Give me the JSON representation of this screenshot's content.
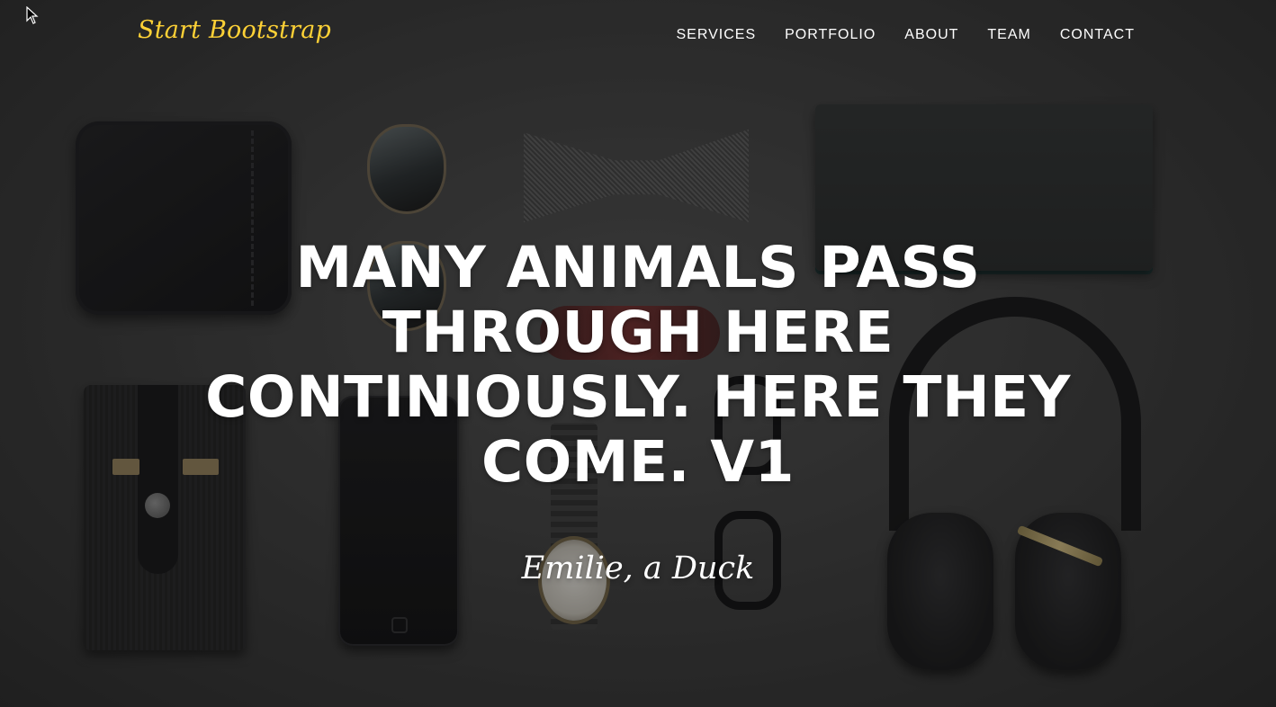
{
  "navbar": {
    "brand": "Start Bootstrap",
    "items": [
      {
        "label": "SERVICES"
      },
      {
        "label": "PORTFOLIO"
      },
      {
        "label": "ABOUT"
      },
      {
        "label": "TEAM"
      },
      {
        "label": "CONTACT"
      }
    ]
  },
  "hero": {
    "heading": "MANY ANIMALS PASS THROUGH HERE CONTINIOUSLY. HERE THEY COME. V1",
    "subheading": "Emilie, a Duck"
  },
  "colors": {
    "brand": "#fed136",
    "text": "#ffffff"
  },
  "icons": {
    "cursor": "mouse-pointer-icon"
  }
}
